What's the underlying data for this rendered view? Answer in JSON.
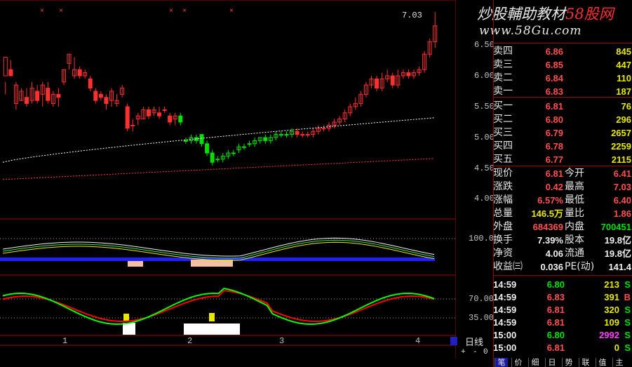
{
  "watermark": {
    "prefix": "炒股輔助教材",
    "accent": "58股网",
    "url": "www.58Gu.com"
  },
  "main_chart": {
    "y_ticks": [
      "6.50",
      "6.00",
      "5.50",
      "5.00",
      "4.50",
      "4.00"
    ],
    "last_price_marker": "7.03",
    "candles": [
      [
        6.0,
        6.3,
        5.9,
        5.7
      ],
      [
        6.1,
        6.0,
        6.05,
        6.25
      ],
      [
        5.55,
        5.85,
        5.45,
        5.9
      ],
      [
        5.6,
        5.75,
        5.6,
        5.8
      ],
      [
        5.65,
        5.55,
        5.5,
        5.8
      ],
      [
        5.6,
        5.8,
        5.55,
        5.9
      ],
      [
        5.75,
        5.6,
        5.55,
        5.85
      ],
      [
        5.7,
        5.85,
        5.5,
        5.9
      ],
      [
        5.8,
        5.6,
        5.55,
        5.9
      ],
      [
        5.55,
        5.7,
        5.5,
        5.75
      ],
      [
        5.7,
        5.65,
        5.5,
        5.8
      ],
      [
        5.9,
        6.1,
        5.85,
        6.1
      ],
      [
        6.2,
        6.35,
        6.1,
        6.35
      ],
      [
        6.0,
        6.1,
        5.95,
        6.3
      ],
      [
        6.1,
        6.0,
        5.95,
        6.15
      ],
      [
        6.0,
        6.05,
        5.95,
        6.1
      ],
      [
        5.95,
        5.8,
        5.75,
        6.0
      ],
      [
        5.75,
        5.6,
        5.55,
        5.8
      ],
      [
        5.7,
        5.65,
        5.6,
        5.75
      ],
      [
        5.65,
        5.55,
        5.45,
        5.7
      ],
      [
        5.6,
        5.75,
        5.5,
        5.8
      ],
      [
        5.55,
        5.6,
        5.5,
        5.7
      ],
      [
        5.7,
        5.8,
        5.65,
        5.85
      ],
      [
        5.5,
        5.15,
        5.1,
        5.55
      ],
      [
        5.2,
        5.2,
        5.1,
        5.3
      ],
      [
        5.3,
        5.35,
        5.2,
        5.4
      ],
      [
        5.3,
        5.45,
        5.3,
        5.5
      ],
      [
        5.45,
        5.35,
        5.3,
        5.5
      ],
      [
        5.4,
        5.45,
        5.35,
        5.5
      ],
      [
        5.4,
        5.35,
        5.3,
        5.5
      ],
      [
        5.45,
        5.45,
        5.4,
        5.5
      ],
      [
        5.35,
        5.25,
        5.2,
        5.4
      ],
      [
        5.3,
        5.35,
        5.2,
        5.4
      ],
      [
        5.35,
        5.25,
        5.2,
        5.4
      ],
      [
        4.95,
        4.95,
        4.9,
        5.0
      ],
      [
        4.95,
        5.0,
        4.9,
        5.05
      ],
      [
        5.0,
        4.95,
        4.9,
        5.05
      ],
      [
        5.05,
        4.9,
        4.85,
        5.05
      ],
      [
        4.9,
        4.75,
        4.7,
        4.95
      ],
      [
        4.75,
        4.6,
        4.55,
        4.8
      ],
      [
        4.65,
        4.65,
        4.6,
        4.7
      ],
      [
        4.65,
        4.7,
        4.6,
        4.75
      ],
      [
        4.7,
        4.75,
        4.65,
        4.8
      ],
      [
        4.75,
        4.75,
        4.7,
        4.8
      ],
      [
        4.8,
        4.85,
        4.75,
        4.9
      ],
      [
        4.85,
        4.85,
        4.8,
        4.9
      ],
      [
        4.9,
        4.9,
        4.85,
        4.95
      ],
      [
        4.9,
        4.95,
        4.85,
        5.0
      ],
      [
        4.95,
        5.0,
        4.9,
        5.0
      ],
      [
        5.0,
        4.95,
        4.9,
        5.05
      ],
      [
        4.95,
        5.0,
        4.9,
        5.05
      ],
      [
        5.0,
        5.05,
        4.95,
        5.1
      ],
      [
        5.05,
        5.05,
        5.0,
        5.1
      ],
      [
        5.05,
        5.05,
        5.0,
        5.1
      ],
      [
        5.05,
        5.1,
        5.0,
        5.15
      ],
      [
        5.1,
        5.05,
        5.0,
        5.15
      ],
      [
        5.05,
        5.05,
        5.0,
        5.1
      ],
      [
        5.05,
        5.05,
        5.0,
        5.1
      ],
      [
        5.05,
        5.1,
        5.0,
        5.15
      ],
      [
        5.1,
        5.15,
        5.05,
        5.2
      ],
      [
        5.15,
        5.15,
        5.1,
        5.2
      ],
      [
        5.15,
        5.2,
        5.1,
        5.25
      ],
      [
        5.2,
        5.25,
        5.15,
        5.3
      ],
      [
        5.25,
        5.3,
        5.2,
        5.35
      ],
      [
        5.3,
        5.4,
        5.25,
        5.45
      ],
      [
        5.4,
        5.5,
        5.35,
        5.55
      ],
      [
        5.5,
        5.55,
        5.45,
        5.65
      ],
      [
        5.55,
        5.7,
        5.5,
        5.75
      ],
      [
        5.7,
        5.85,
        5.65,
        5.9
      ],
      [
        5.85,
        5.95,
        5.8,
        6.0
      ],
      [
        5.95,
        5.8,
        5.75,
        6.0
      ],
      [
        5.8,
        5.95,
        5.75,
        6.05
      ],
      [
        5.95,
        6.0,
        5.9,
        6.1
      ],
      [
        6.0,
        5.85,
        5.8,
        6.05
      ],
      [
        5.85,
        6.0,
        5.8,
        6.1
      ],
      [
        6.0,
        6.05,
        5.95,
        6.1
      ],
      [
        6.05,
        6.0,
        5.95,
        6.1
      ],
      [
        6.0,
        6.05,
        5.95,
        6.1
      ],
      [
        6.05,
        6.1,
        6.0,
        6.15
      ],
      [
        6.1,
        6.35,
        6.05,
        6.4
      ],
      [
        6.35,
        6.55,
        6.3,
        6.6
      ],
      [
        6.55,
        6.81,
        6.45,
        7.03
      ]
    ],
    "ma_slow_start": 4.6,
    "ma_slow_end": 5.32,
    "ma_long_start": 4.32,
    "ma_long_end": 4.66
  },
  "indicator1": {
    "y_tick": "100.0"
  },
  "indicator2": {
    "y_ticks": [
      "70.00",
      "35.00"
    ]
  },
  "x_axis": {
    "labels": [
      "1",
      "2",
      "3",
      "4"
    ]
  },
  "period": "日线",
  "controls": {
    "plus": "+",
    "minus": "-",
    "zero": "0"
  },
  "order_book": {
    "asks": [
      {
        "label": "卖四",
        "price": "6.86",
        "vol": "845"
      },
      {
        "label": "卖三",
        "price": "6.85",
        "vol": "447"
      },
      {
        "label": "卖二",
        "price": "6.84",
        "vol": "110"
      },
      {
        "label": "卖一",
        "price": "6.83",
        "vol": "187"
      }
    ],
    "bids": [
      {
        "label": "买一",
        "price": "6.81",
        "vol": "76"
      },
      {
        "label": "买二",
        "price": "6.80",
        "vol": "296"
      },
      {
        "label": "买三",
        "price": "6.79",
        "vol": "2657"
      },
      {
        "label": "买四",
        "price": "6.78",
        "vol": "2259"
      },
      {
        "label": "买五",
        "price": "6.77",
        "vol": "2115"
      }
    ]
  },
  "quote": [
    {
      "l1": "现价",
      "v1": "6.81",
      "l2": "今开",
      "v2": "6.41",
      "c1": "red",
      "c2": "red"
    },
    {
      "l1": "涨跌",
      "v1": "0.42",
      "l2": "最高",
      "v2": "7.03",
      "c1": "red",
      "c2": "red"
    },
    {
      "l1": "涨幅",
      "v1": "6.57%",
      "l2": "最低",
      "v2": "6.40",
      "c1": "red",
      "c2": "red"
    },
    {
      "l1": "总量",
      "v1": "146.5万",
      "l2": "量比",
      "v2": "1.86",
      "c1": "yellow",
      "c2": "red"
    },
    {
      "l1": "外盘",
      "v1": "684369",
      "l2": "内盘",
      "v2": "700451",
      "c1": "red",
      "c2": "green"
    },
    {
      "l1": "换手",
      "v1": "7.39%",
      "l2": "股本",
      "v2": "19.8亿",
      "c1": "white",
      "c2": "white"
    },
    {
      "l1": "净资",
      "v1": "4.06",
      "l2": "流通",
      "v2": "19.8亿",
      "c1": "white",
      "c2": "white"
    },
    {
      "l1": "收益㈢",
      "v1": "0.036",
      "l2": "PE(动)",
      "v2": "141.4",
      "c1": "white",
      "c2": "white"
    }
  ],
  "ticks": [
    {
      "time": "14:59",
      "price": "6.80",
      "vol": "213",
      "side": "S"
    },
    {
      "time": "14:59",
      "price": "6.83",
      "vol": "391",
      "side": "B"
    },
    {
      "time": "14:59",
      "price": "6.81",
      "vol": "320",
      "side": "S"
    },
    {
      "time": "14:59",
      "price": "6.81",
      "vol": "109",
      "side": "S"
    },
    {
      "time": "15:00",
      "price": "6.80",
      "vol": "2992",
      "side": "S"
    },
    {
      "time": "15:00",
      "price": "6.81",
      "vol": "0",
      "side": "S"
    }
  ],
  "tabs": [
    "笔",
    "价",
    "细",
    "日",
    "势",
    "联",
    "值",
    "主"
  ],
  "colors": {
    "up": "#ff3030",
    "down": "#00e000",
    "grid": "#8b0000",
    "ma_fast": "#ffffff",
    "ma_slow": "#ff4040",
    "kdj_k": "#00ff00",
    "kdj_d": "#ff0000",
    "volume_bar": "#2020ff",
    "separator": "#a00000"
  }
}
